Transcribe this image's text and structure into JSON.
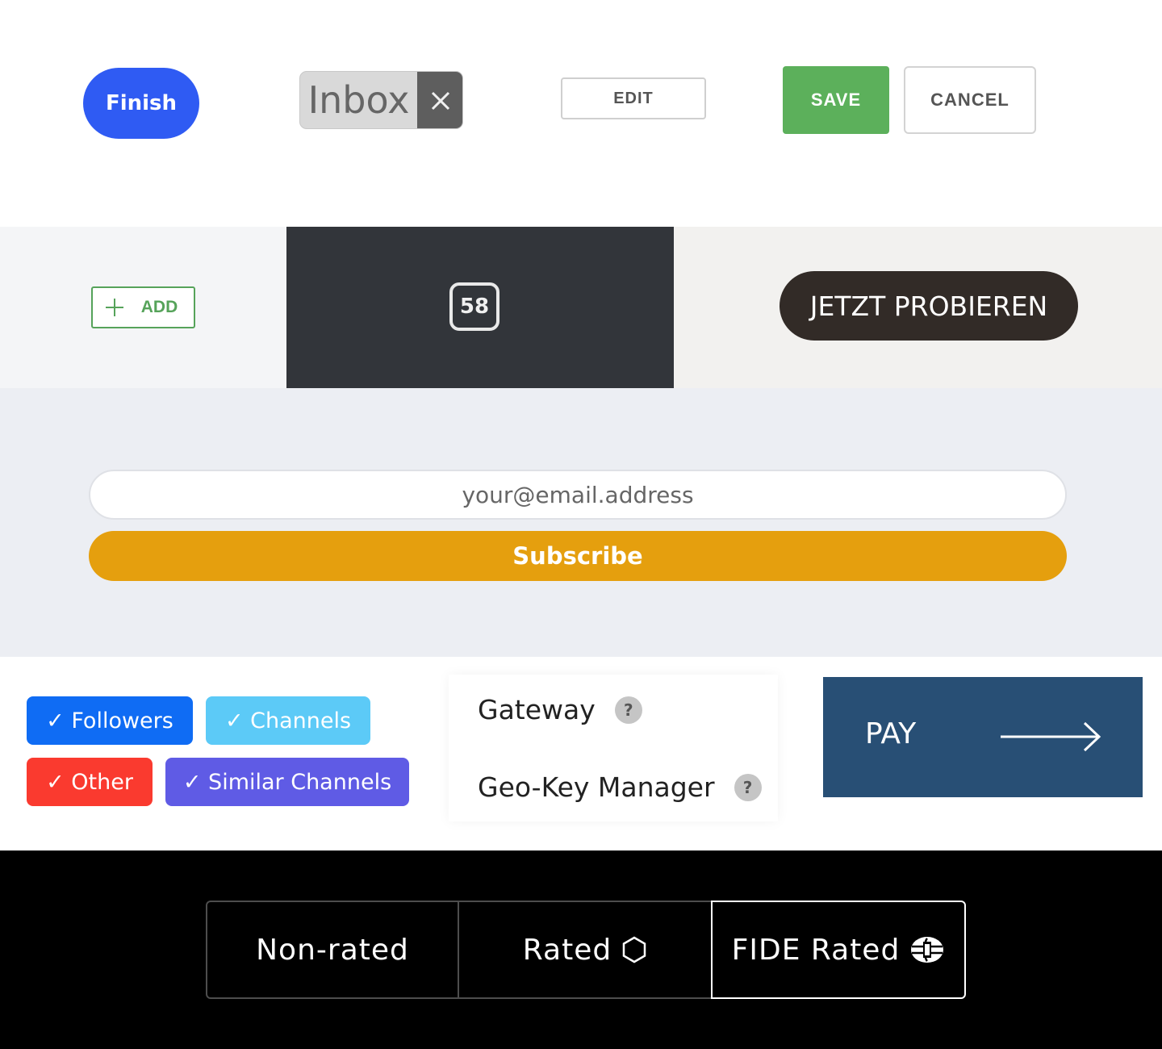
{
  "buttons": {
    "finish": "Finish",
    "inbox": "Inbox",
    "edit": "EDIT",
    "save": "SAVE",
    "cancel": "CANCEL",
    "add": "ADD",
    "counter": "58",
    "jetzt": "JETZT PROBIEREN"
  },
  "subscribe_form": {
    "email_placeholder": "your@email.address",
    "subscribe_label": "Subscribe"
  },
  "tags": [
    {
      "label": "✓ Followers",
      "color": "#0f6cf4"
    },
    {
      "label": "✓ Channels",
      "color": "#5ccaf7"
    },
    {
      "label": "✓ Other",
      "color": "#fa3a2f"
    },
    {
      "label": "✓ Similar Channels",
      "color": "#5f5be5"
    }
  ],
  "menu": {
    "items": [
      {
        "label": "Gateway",
        "help": "?"
      },
      {
        "label": "Geo-Key Manager",
        "help": "?"
      }
    ]
  },
  "pay": {
    "label": "PAY",
    "color": "#284f75",
    "icon": "arrow-right-icon"
  },
  "rating_tabs": [
    {
      "label": "Non-rated",
      "selected": false
    },
    {
      "label": "Rated",
      "selected": false,
      "icon": "hexagon-icon"
    },
    {
      "label": "FIDE Rated",
      "selected": true,
      "icon": "fide-icon"
    }
  ],
  "colors": {
    "finish": "#2f5bf3",
    "save": "#5cb05b",
    "add": "#56a35a",
    "subscribe": "#e59f0e",
    "jetzt": "#322b27"
  }
}
